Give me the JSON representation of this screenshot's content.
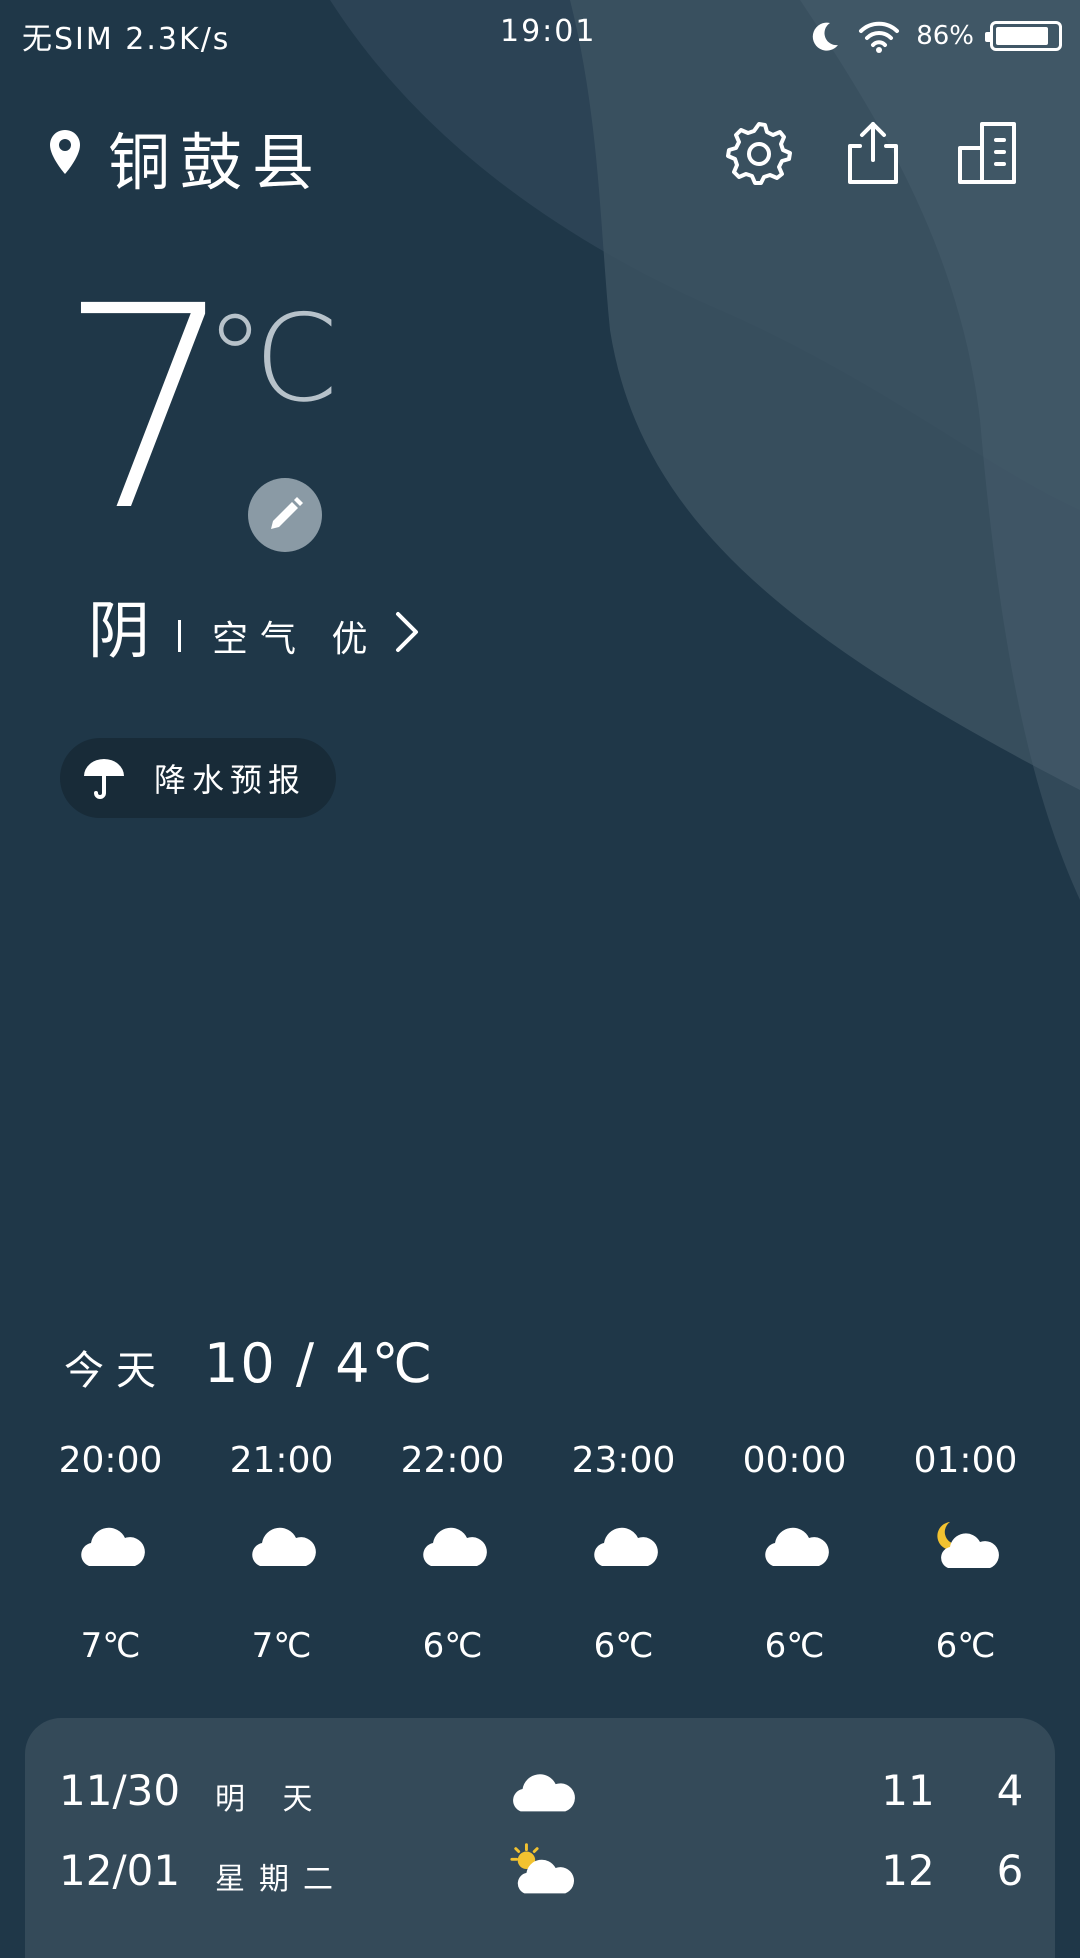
{
  "status_bar": {
    "carrier_speed": "无SIM 2.3K/s",
    "time": "19:01",
    "battery_percent": "86%",
    "battery_level": 0.86
  },
  "header": {
    "city": "铜鼓县"
  },
  "current": {
    "temperature": "7",
    "unit": "℃",
    "condition": "阴",
    "air_quality": "空气 优"
  },
  "rain_forecast": {
    "label": "降水预报"
  },
  "today": {
    "label": "今天",
    "range": "10 / 4℃"
  },
  "hourly": [
    {
      "time": "20:00",
      "icon": "cloud",
      "temp": "7℃"
    },
    {
      "time": "21:00",
      "icon": "cloud",
      "temp": "7℃"
    },
    {
      "time": "22:00",
      "icon": "cloud",
      "temp": "6℃"
    },
    {
      "time": "23:00",
      "icon": "cloud",
      "temp": "6℃"
    },
    {
      "time": "00:00",
      "icon": "cloud",
      "temp": "6℃"
    },
    {
      "time": "01:00",
      "icon": "moon-cloud",
      "temp": "6℃"
    }
  ],
  "daily": [
    {
      "date": "11/30",
      "name": "明 天",
      "icon": "cloud",
      "high": "11",
      "low": "4"
    },
    {
      "date": "12/01",
      "name": "星期二",
      "icon": "sun-cloud",
      "high": "12",
      "low": "6"
    }
  ],
  "colors": {
    "background": "#1f3748",
    "card": "#344a59",
    "pill": "#182b38",
    "accent_sun": "#f2c230"
  }
}
